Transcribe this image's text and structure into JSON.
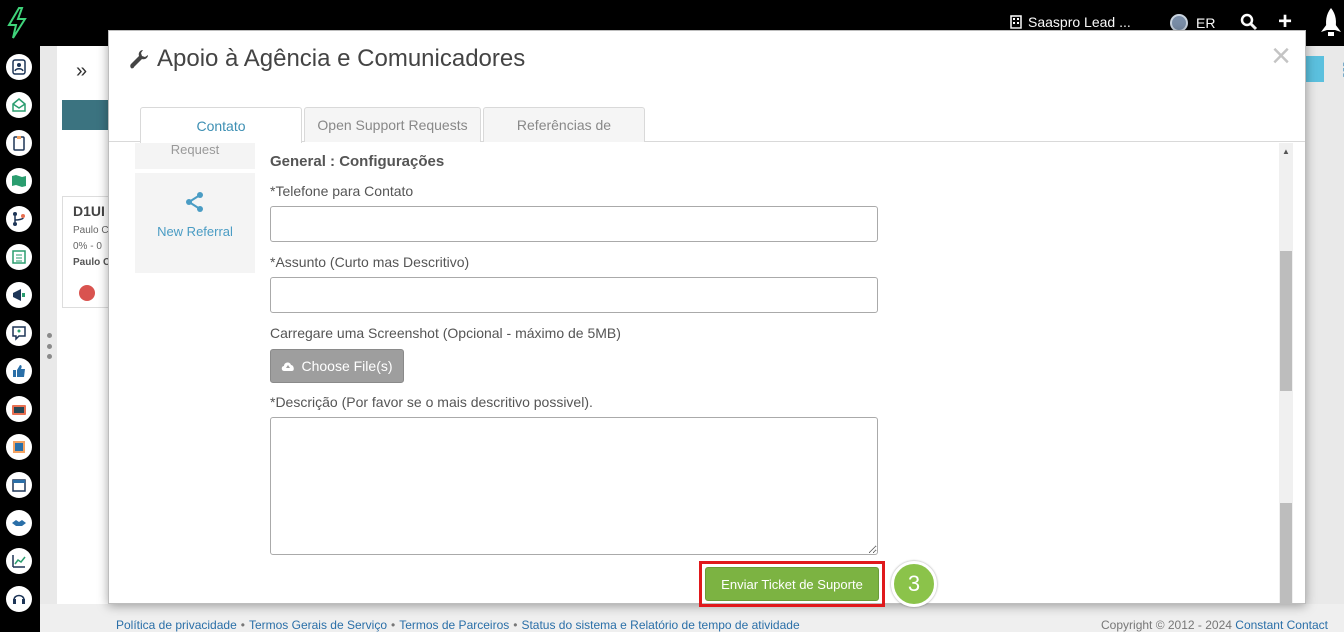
{
  "topbar": {
    "org_name": "Saaspro Lead ...",
    "user_initials": "ER"
  },
  "modal": {
    "title": "Apoio à Agência e Comunicadores",
    "close_label": "×",
    "tabs": [
      {
        "label": "Contato",
        "active": true
      },
      {
        "label": "Open Support Requests",
        "active": false
      },
      {
        "label": "Referências de",
        "active": false
      }
    ],
    "side_nav": {
      "request_label": "Request",
      "new_referral_label": "New Referral"
    },
    "form": {
      "section_title": "General : Configurações",
      "phone_label": "*Telefone para Contato",
      "subject_label": "*Assunto (Curto mas Descritivo)",
      "screenshot_label": "Carregare uma Screenshot (Opcional - máximo de 5MB)",
      "file_button": "Choose File(s)",
      "description_label": "*Descrição (Por favor se o mais descritivo possivel).",
      "submit_label": "Enviar Ticket de Suporte",
      "step_number": "3"
    }
  },
  "background": {
    "card_title": "D1UI",
    "card_line1": "Paulo C",
    "card_line2": "0% - 0",
    "card_line3": "Paulo C"
  },
  "footer": {
    "links": [
      "Política de privacidade",
      "Termos Gerais de Serviço",
      "Termos de Parceiros",
      "Status do sistema e Relatório de tempo de atividade"
    ],
    "copyright": "Copyright © 2012 - 2024",
    "copyright_link": "Constant Contact"
  },
  "colors": {
    "accent_green": "#7cb342",
    "highlight_red": "#e0191c",
    "tab_active_text": "#3d8fb3"
  }
}
